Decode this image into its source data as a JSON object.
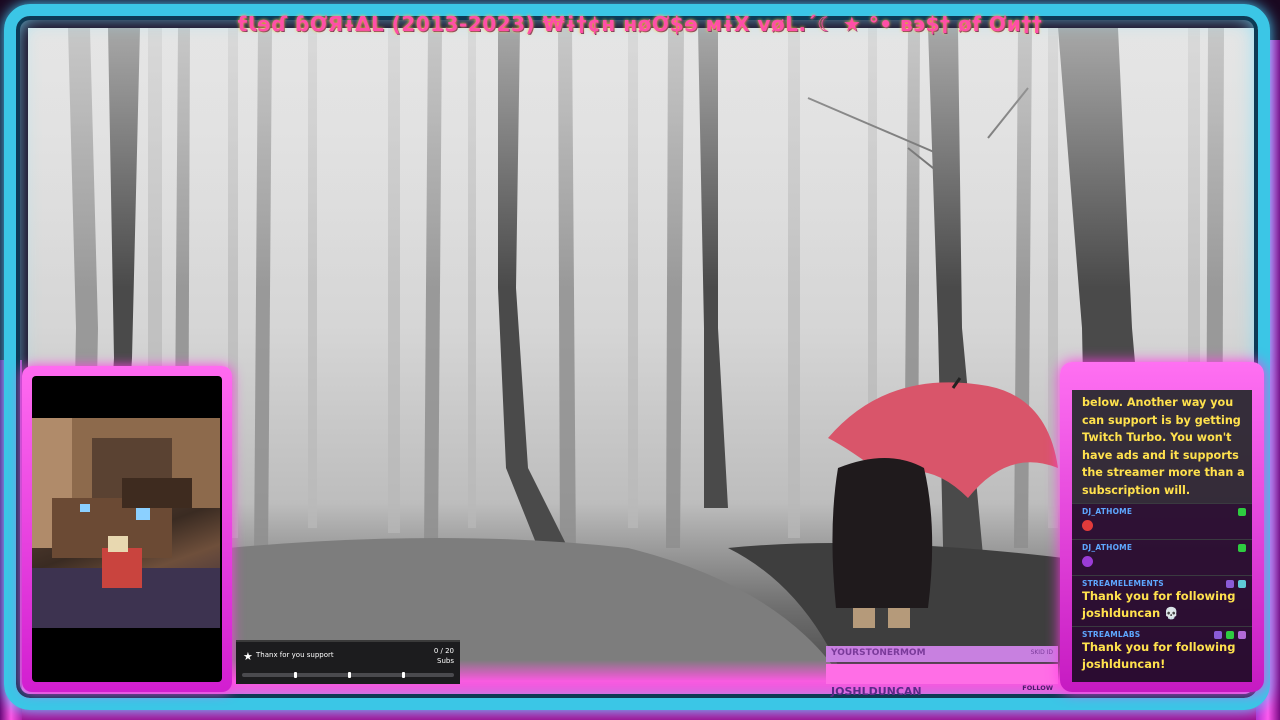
{
  "title": "ƭƖɘɗ ɓƠЯɨΔL (2013-2023) ₩ɨ†¢н нøƠ$ɘ мɨX vøL.´☾ ★ °• вэ$† øf Ơи††",
  "goal": {
    "label": "Thanx for you support",
    "count": "0 / 20",
    "unit": "Subs",
    "progress": 0
  },
  "follower": {
    "previous": "YOURSTONERMOM",
    "previous_tag": "SKID ID",
    "latest": "JOSHLDUNCAN",
    "latest_tag": "FOLLOW"
  },
  "chat": {
    "first_message": "below. Another way you can support is by getting Twitch Turbo. You won't have ads and it supports the streamer more than a subscription will.",
    "messages": [
      {
        "user": "DJ_ATHOME",
        "text": "",
        "emote": "mushroom-emote",
        "emote_color": "#e23b3b"
      },
      {
        "user": "DJ_ATHOME",
        "text": "",
        "emote": "grape-emote",
        "emote_color": "#9b3cd6"
      },
      {
        "user": "STREAMELEMENTS",
        "text": "Thank you for following joshlduncan 💀"
      },
      {
        "user": "STREAMLABS",
        "text": "Thank you for following joshlduncan!"
      }
    ]
  },
  "colors": {
    "frame_cyan": "#3bc6e6",
    "frame_magenta": "#ff55e0",
    "chat_text": "#ffe14d",
    "chat_user": "#5ea7ff"
  }
}
